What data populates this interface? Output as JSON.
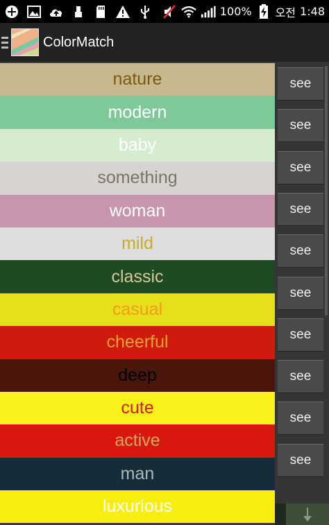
{
  "status_bar": {
    "battery_percent": "100%",
    "carrier_text": "오전",
    "time": "1:48",
    "icons_left": [
      "add-icon",
      "image-icon",
      "cloud-upload-icon",
      "usb-icon",
      "sd-card-icon",
      "warning-icon",
      "usb-debug-icon"
    ],
    "icons_right": [
      "mute-icon",
      "wifi-icon",
      "signal-icon",
      "battery-charging-icon"
    ]
  },
  "action_bar": {
    "title": "ColorMatch",
    "icon": "colormatch-app-icon"
  },
  "rows": [
    {
      "label": "nature",
      "bg": "#c8b88e",
      "fg": "#7a5a10"
    },
    {
      "label": "modern",
      "bg": "#7fc89a",
      "fg": "#ffffff"
    },
    {
      "label": "baby",
      "bg": "#d6ecd0",
      "fg": "#ffffff"
    },
    {
      "label": "something",
      "bg": "#d6d3d0",
      "fg": "#7b7366"
    },
    {
      "label": "woman",
      "bg": "#c894ae",
      "fg": "#ffffff"
    },
    {
      "label": "mild",
      "bg": "#dedede",
      "fg": "#c8ac28"
    },
    {
      "label": "classic",
      "bg": "#1e4a24",
      "fg": "#d8c89a"
    },
    {
      "label": "casual",
      "bg": "#e6e01c",
      "fg": "#f59a1a"
    },
    {
      "label": "cheerful",
      "bg": "#d01a0e",
      "fg": "#f8a030"
    },
    {
      "label": "deep",
      "bg": "#4a160c",
      "fg": "#000000"
    },
    {
      "label": "cute",
      "bg": "#f8f21a",
      "fg": "#d81a10"
    },
    {
      "label": "active",
      "bg": "#d8180e",
      "fg": "#d6a660"
    },
    {
      "label": "man",
      "bg": "#162c38",
      "fg": "#a8b8be"
    },
    {
      "label": "luxurious",
      "bg": "#f8ee10",
      "fg": "#ffffff"
    }
  ],
  "see_label": "see",
  "see_count": 10
}
